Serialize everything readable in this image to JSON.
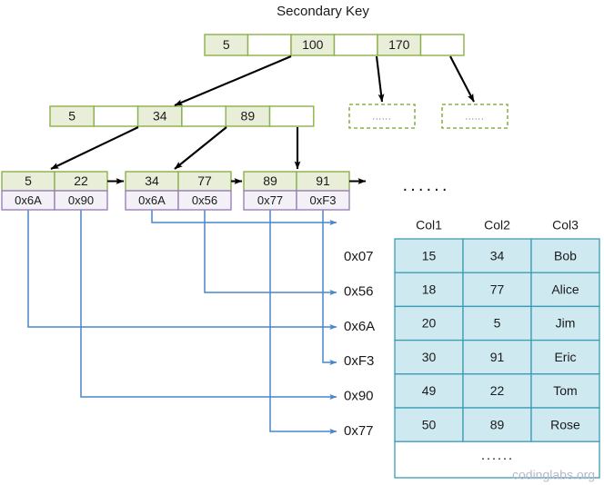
{
  "title": "Secondary Key",
  "colors": {
    "key_fill": "#e9eed9",
    "key_stroke": "#8cb04a",
    "ptr_fill": "#f3f0f7",
    "ptr_stroke": "#9b81b9",
    "arrow_black": "#000000",
    "link_blue": "#4a86c8",
    "table_fill": "#cfe9f1",
    "table_stroke": "#3a9cb4",
    "watermark": "#b9b9c6",
    "background": "#ffffff"
  },
  "tree": {
    "root": {
      "cells": [
        {
          "label": "5",
          "type": "key"
        },
        {
          "label": "",
          "type": "pointer"
        },
        {
          "label": "100",
          "type": "key"
        },
        {
          "label": "",
          "type": "pointer"
        },
        {
          "label": "170",
          "type": "key"
        },
        {
          "label": "",
          "type": "pointer"
        }
      ]
    },
    "level2": {
      "cells": [
        {
          "label": "5",
          "type": "key"
        },
        {
          "label": "",
          "type": "pointer"
        },
        {
          "label": "34",
          "type": "key"
        },
        {
          "label": "",
          "type": "pointer"
        },
        {
          "label": "89",
          "type": "key"
        },
        {
          "label": "",
          "type": "pointer"
        }
      ]
    },
    "placeholder_nodes": [
      {
        "label": "......"
      },
      {
        "label": "......"
      }
    ],
    "leaves": [
      {
        "keys": [
          "5",
          "22"
        ],
        "pointers": [
          "0x6A",
          "0x90"
        ]
      },
      {
        "keys": [
          "34",
          "77"
        ],
        "pointers": [
          "0x6A",
          "0x56"
        ]
      },
      {
        "keys": [
          "89",
          "91"
        ],
        "pointers": [
          "0x77",
          "0xF3"
        ]
      }
    ],
    "leaf_overflow_label": "······"
  },
  "addresses": [
    {
      "label": "0x07"
    },
    {
      "label": "0x56"
    },
    {
      "label": "0x6A"
    },
    {
      "label": "0xF3"
    },
    {
      "label": "0x90"
    },
    {
      "label": "0x77"
    }
  ],
  "table": {
    "headers": [
      "Col1",
      "Col2",
      "Col3"
    ],
    "rows": [
      [
        "15",
        "34",
        "Bob"
      ],
      [
        "18",
        "77",
        "Alice"
      ],
      [
        "20",
        "5",
        "Jim"
      ],
      [
        "30",
        "91",
        "Eric"
      ],
      [
        "49",
        "22",
        "Tom"
      ],
      [
        "50",
        "89",
        "Rose"
      ]
    ],
    "overflow_label": "······"
  },
  "watermark": "codinglabs.org"
}
